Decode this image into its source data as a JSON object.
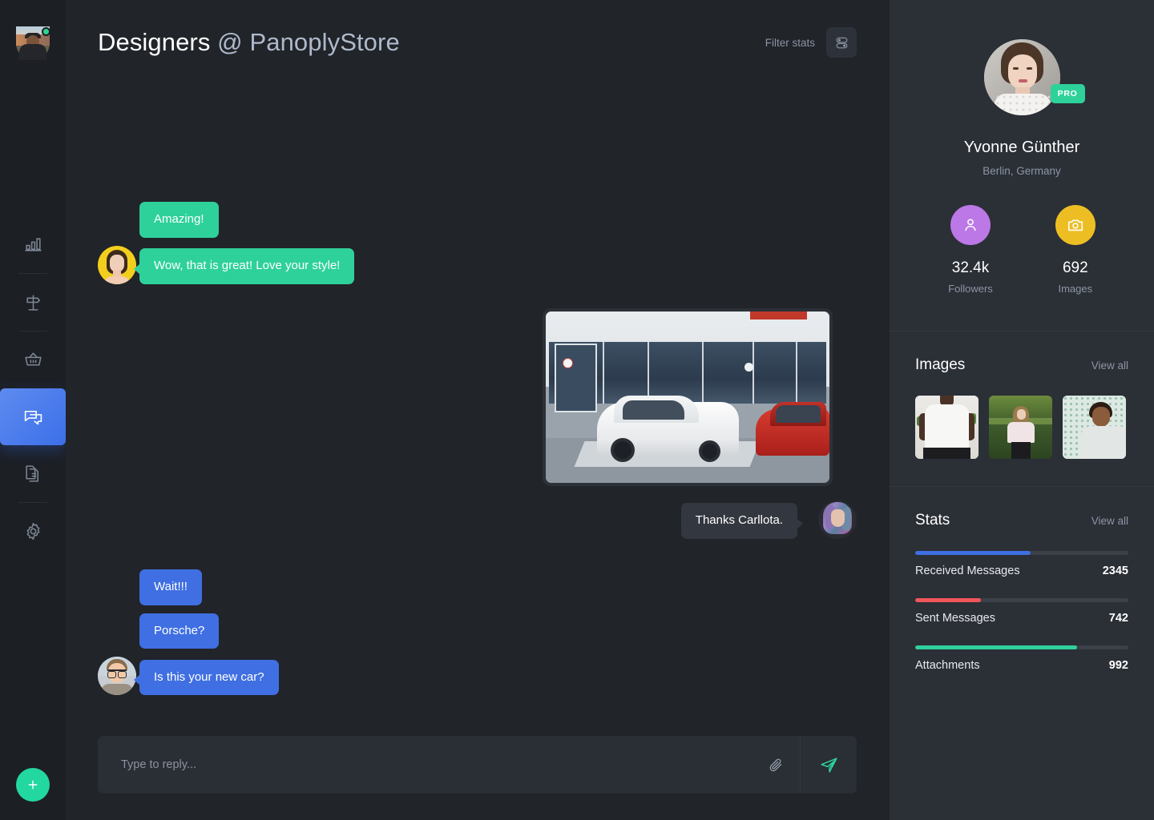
{
  "colors": {
    "bg_main": "#212429",
    "bg_nav": "#1c1f24",
    "bg_panel": "#2b2f36",
    "accent_green": "#2ed19a",
    "accent_blue": "#3f6fe2",
    "bubble_gray": "#33373f",
    "stat_blue": "#3f6fe2",
    "stat_red": "#f2555a",
    "stat_green": "#2ed19a",
    "followers_circle": "#bb78e6",
    "images_circle": "#edbe23"
  },
  "leftnav": {
    "avatar_name": "user-avatar",
    "status": "online",
    "items": [
      {
        "id": "analytics",
        "icon": "bar-chart-icon",
        "active": false
      },
      {
        "id": "directions",
        "icon": "signpost-icon",
        "active": false
      },
      {
        "id": "shop",
        "icon": "basket-icon",
        "active": false
      },
      {
        "id": "messages",
        "icon": "chat-icon",
        "active": true
      },
      {
        "id": "documents",
        "icon": "documents-icon",
        "active": false
      },
      {
        "id": "settings",
        "icon": "gear-icon",
        "active": false
      }
    ],
    "add_button": {
      "icon": "plus-icon",
      "label": "+"
    }
  },
  "header": {
    "title_strong": "Designers",
    "title_muted": " @ PanoplyStore",
    "filter_label": "Filter stats",
    "filter_icon": "sliders-toggle-icon"
  },
  "conversation": {
    "groups": [
      {
        "side": "left",
        "avatar": "av-a",
        "avatar_name": "avatar-carllota",
        "color": "green",
        "messages": [
          "Amazing!",
          "Wow, that is great! Love your style!"
        ]
      },
      {
        "side": "right",
        "type": "photo",
        "photo_name": "porsche-photo-message",
        "photo_alt": "White Porsche 911 parked in front of a dealership with a red car beside it"
      },
      {
        "side": "right",
        "avatar": "av-b",
        "avatar_name": "avatar-yvonne",
        "color": "gray",
        "messages": [
          "Thanks Carllota."
        ]
      },
      {
        "side": "left",
        "avatar": "av-c",
        "avatar_name": "avatar-friend",
        "color": "blue",
        "messages": [
          "Wait!!!",
          "Porsche?",
          "Is this your new car?"
        ]
      }
    ]
  },
  "composer": {
    "placeholder": "Type to reply...",
    "value": "",
    "attach_icon": "paperclip-icon",
    "send_icon": "send-plane-icon"
  },
  "profile": {
    "avatar_name": "profile-avatar",
    "badge": "PRO",
    "name": "Yvonne Günther",
    "location": "Berlin, Germany",
    "counters": [
      {
        "icon": "person-icon",
        "value": "32.4k",
        "label": "Followers"
      },
      {
        "icon": "camera-icon",
        "value": "692",
        "label": "Images"
      }
    ]
  },
  "images_section": {
    "title": "Images",
    "link": "View all",
    "thumbs": [
      {
        "id": "t1",
        "alt": "Man wearing a plain white t-shirt in front of plant shelves"
      },
      {
        "id": "t2",
        "alt": "Woman in a white t-shirt standing outdoors on green grass"
      },
      {
        "id": "t3",
        "alt": "Man in a light grey t-shirt against a patterned wall"
      }
    ]
  },
  "stats_section": {
    "title": "Stats",
    "link": "View all",
    "items": [
      {
        "name": "Received Messages",
        "value": "2345",
        "percent": 54,
        "color": "#3f6fe2"
      },
      {
        "name": "Sent Messages",
        "value": "742",
        "percent": 31,
        "color": "#f2555a"
      },
      {
        "name": "Attachments",
        "value": "992",
        "percent": 76,
        "color": "#2ed19a"
      }
    ]
  },
  "chart_data": {
    "type": "bar",
    "title": "Stats",
    "categories": [
      "Received Messages",
      "Sent Messages",
      "Attachments"
    ],
    "values": [
      2345,
      742,
      992
    ],
    "bar_percent": [
      54,
      31,
      76
    ],
    "colors": [
      "#3f6fe2",
      "#f2555a",
      "#2ed19a"
    ],
    "xlabel": "",
    "ylabel": "",
    "legend": "none",
    "grid": false
  }
}
